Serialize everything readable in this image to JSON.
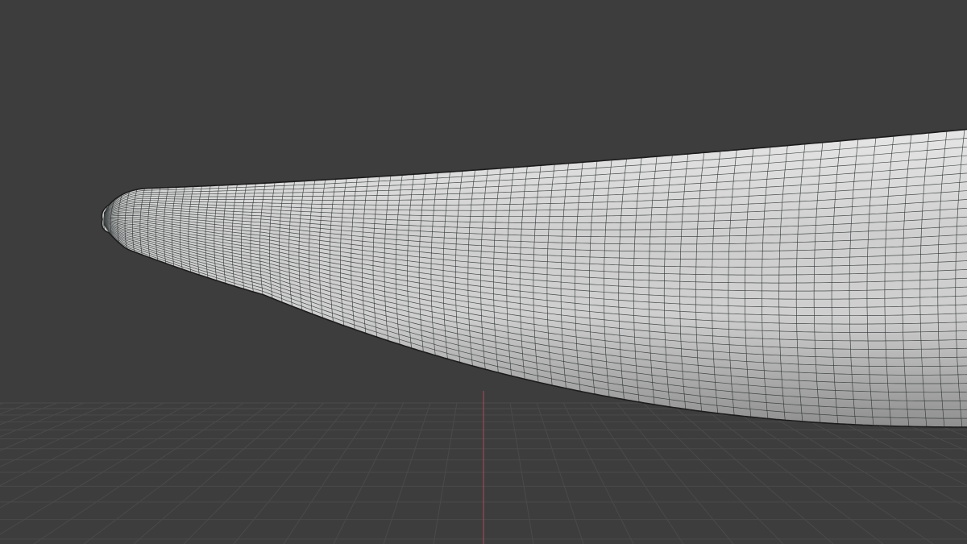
{
  "viewport": {
    "mode": "3d-viewport",
    "shading": "solid",
    "overlay_wireframe": true,
    "show_floor_grid": true,
    "show_y_axis_line": true
  },
  "colors": {
    "background": "#3d3d3d",
    "floor_grid_line": "#4a4a4a",
    "y_axis_line": "#9a4a52",
    "mesh_surface": "#cfcfcf",
    "mesh_shadow": "#8f8f8f",
    "mesh_highlight": "#e6e6e6",
    "wire_line": "#2f3434",
    "outline": "#1c1c1c"
  },
  "scene": {
    "objects": [
      {
        "name": "mesh-object",
        "type": "subdivided-blade-mesh",
        "selected": false
      }
    ]
  }
}
